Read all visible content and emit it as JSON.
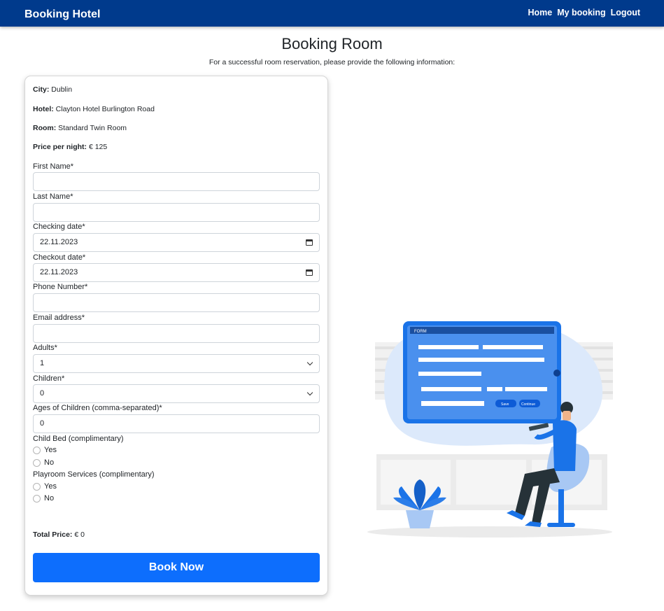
{
  "navbar": {
    "brand": "Booking Hotel",
    "links": [
      "Home",
      "My booking",
      "Logout"
    ]
  },
  "page": {
    "title": "Booking Room",
    "subtitle": "For a successful room reservation, please provide the following information:"
  },
  "info": {
    "city_label": "City:",
    "city": "Dublin",
    "hotel_label": "Hotel:",
    "hotel": "Clayton Hotel Burlington Road",
    "room_label": "Room:",
    "room": "Standard Twin Room",
    "price_label": "Price per night:",
    "price": "€ 125"
  },
  "form": {
    "first_name_label": "First Name*",
    "first_name_value": "",
    "last_name_label": "Last Name*",
    "last_name_value": "",
    "checkin_label": "Checking date*",
    "checkin_value": "22.11.2023",
    "checkout_label": "Checkout date*",
    "checkout_value": "22.11.2023",
    "phone_label": "Phone Number*",
    "phone_value": "",
    "email_label": "Email address*",
    "email_value": "",
    "adults_label": "Adults*",
    "adults_value": "1",
    "children_label": "Children*",
    "children_value": "0",
    "ages_label": "Ages of Children (comma-separated)*",
    "ages_value": "0",
    "child_bed_label": "Child Bed (complimentary)",
    "child_bed_options": [
      "Yes",
      "No"
    ],
    "playroom_label": "Playroom Services (complimentary)",
    "playroom_options": [
      "Yes",
      "No"
    ]
  },
  "total": {
    "label": "Total Price:",
    "value": "€ 0"
  },
  "book_button": "Book Now",
  "illustration": {
    "form_header": "FORM",
    "save": "Save",
    "continue": "Continue"
  },
  "colors": {
    "navbar": "#003a8c",
    "primary": "#0d6efd",
    "illustration": "#1a73e8"
  }
}
